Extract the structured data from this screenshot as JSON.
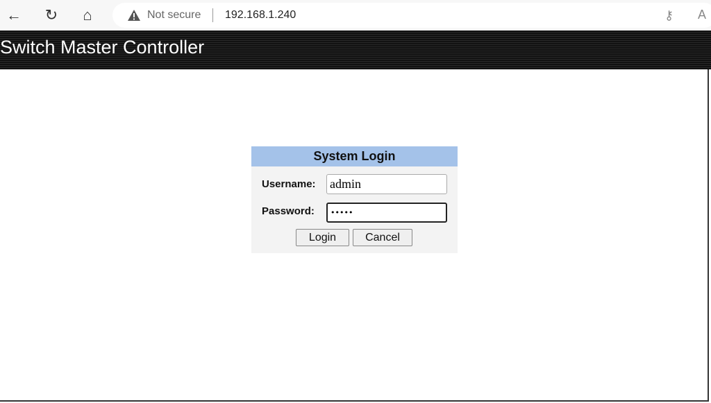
{
  "browser": {
    "security_label": "Not secure",
    "url": "192.168.1.240",
    "icons": [
      "back-arrow-icon",
      "refresh-icon",
      "home-icon",
      "warning-icon",
      "key-icon",
      "read-aloud-icon"
    ]
  },
  "header": {
    "title": "Switch Master Controller"
  },
  "login": {
    "title": "System Login",
    "username_label": "Username:",
    "username_value": "admin",
    "password_label": "Password:",
    "password_value": "•••••",
    "login_button": "Login",
    "cancel_button": "Cancel"
  },
  "colors": {
    "login_header": "#a4c2e9",
    "page_header": "#1a1a1a"
  }
}
